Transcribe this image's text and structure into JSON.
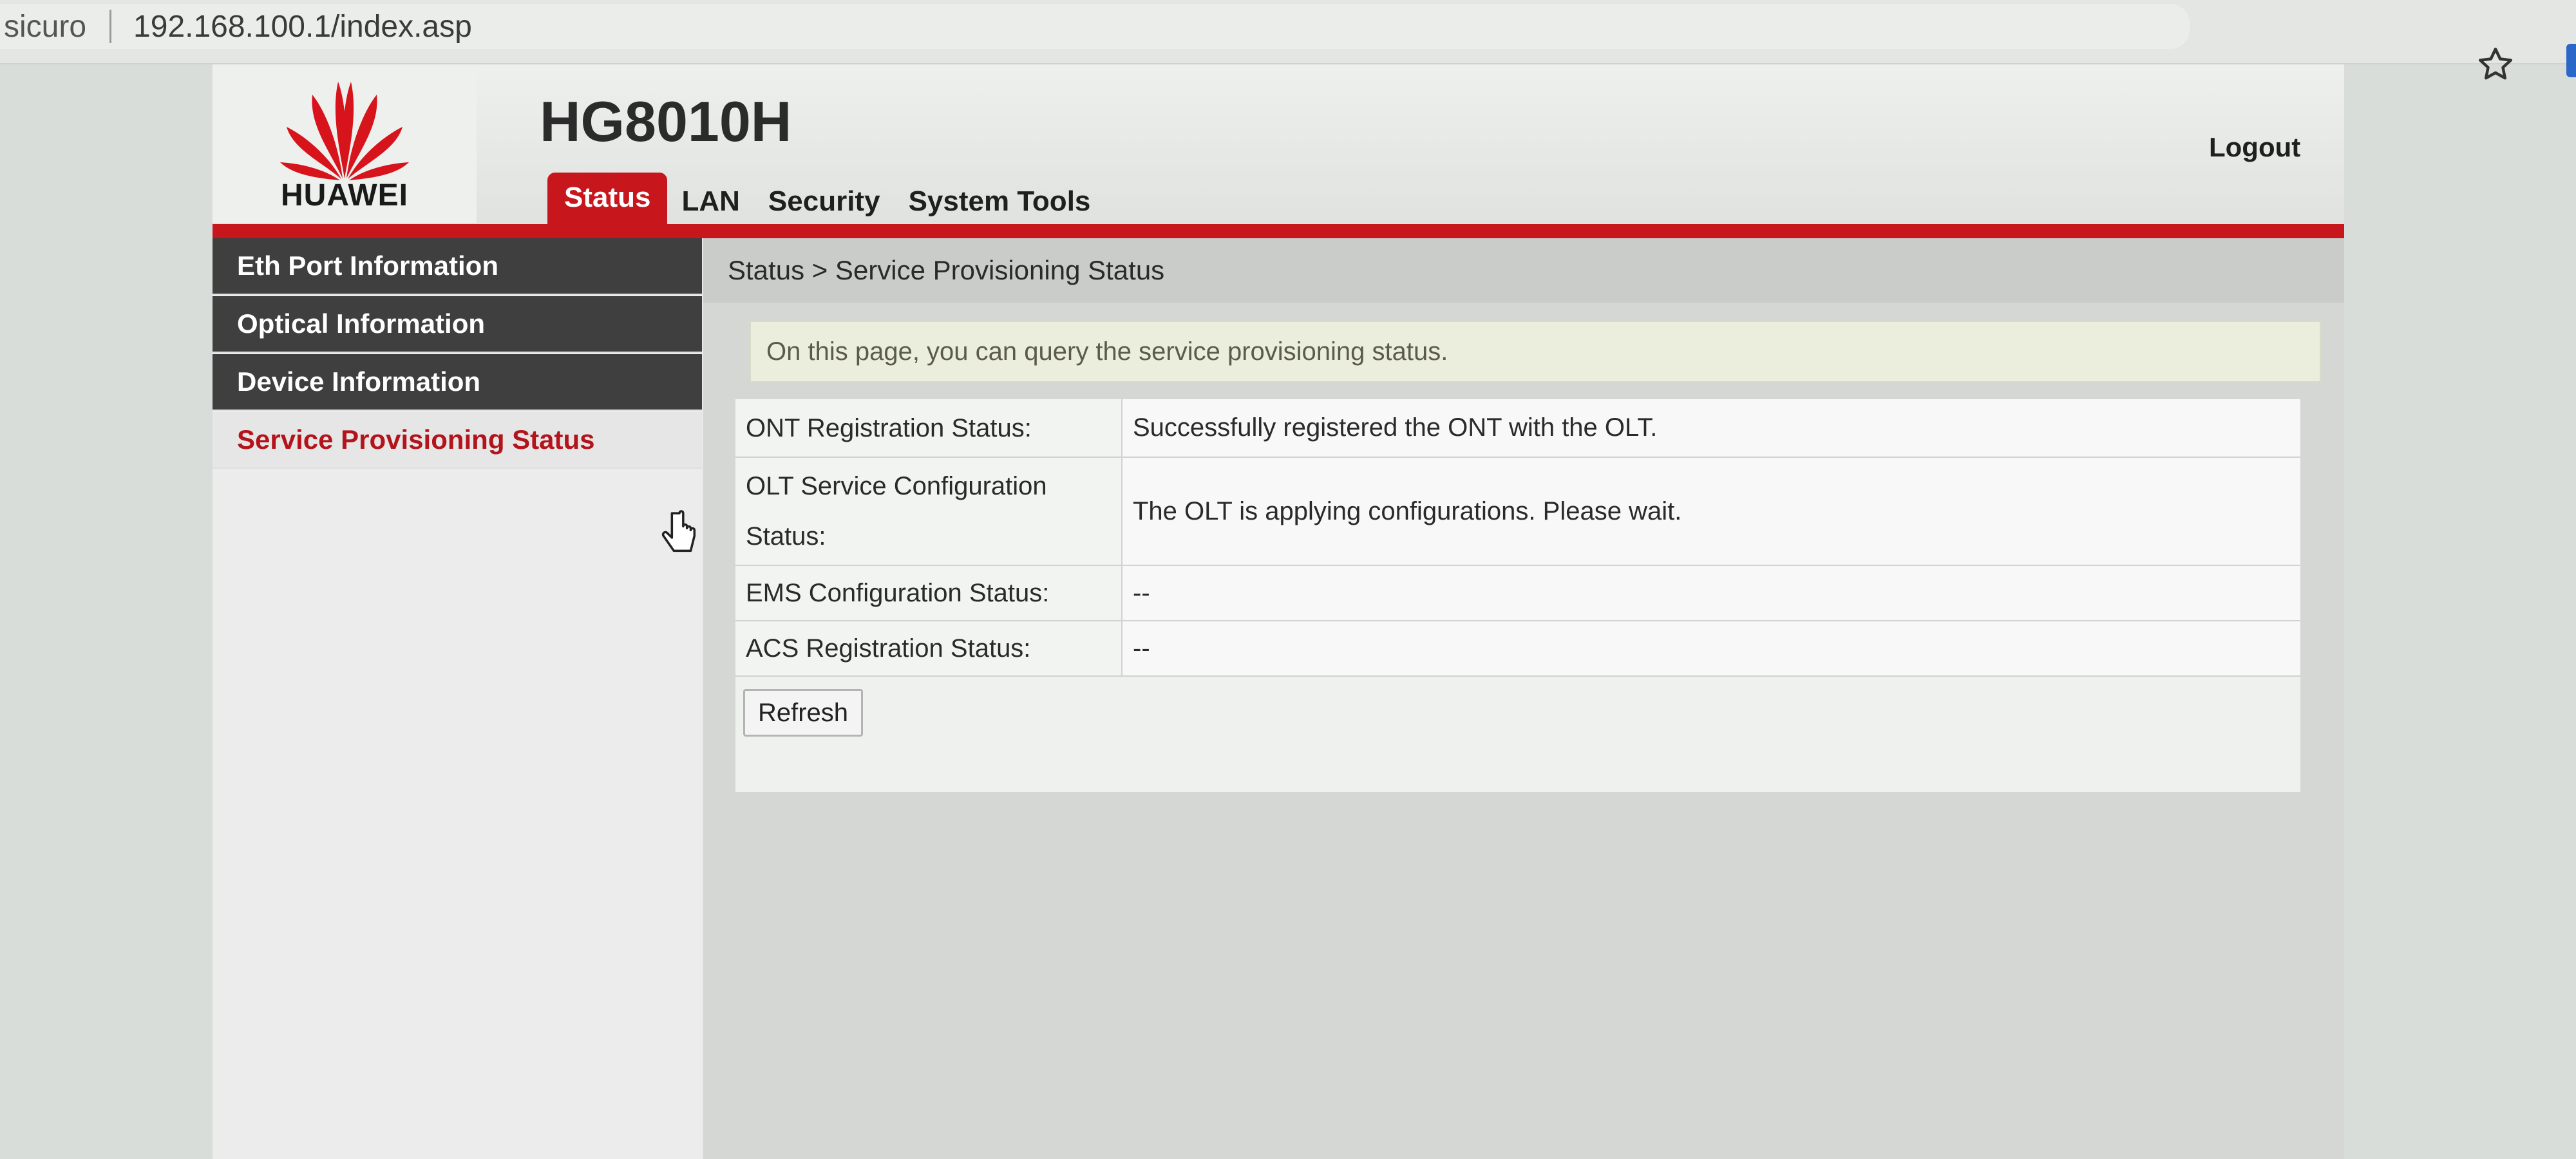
{
  "browser": {
    "security_label": "sicuro",
    "url": "192.168.100.1/index.asp"
  },
  "header": {
    "brand": "HUAWEI",
    "model": "HG8010H",
    "logout_label": "Logout",
    "tabs": [
      {
        "label": "Status",
        "active": true
      },
      {
        "label": "LAN",
        "active": false
      },
      {
        "label": "Security",
        "active": false
      },
      {
        "label": "System Tools",
        "active": false
      }
    ]
  },
  "sidebar": {
    "items": [
      {
        "label": "Eth Port Information",
        "active": false
      },
      {
        "label": "Optical Information",
        "active": false
      },
      {
        "label": "Device Information",
        "active": false
      },
      {
        "label": "Service Provisioning Status",
        "active": true
      }
    ]
  },
  "main": {
    "breadcrumb": "Status > Service Provisioning Status",
    "notice": "On this page, you can query the service provisioning status.",
    "rows": [
      {
        "label": "ONT Registration Status:",
        "value": "Successfully registered the ONT with the OLT."
      },
      {
        "label": "OLT Service Configuration Status:",
        "value": "The OLT is applying configurations. Please wait."
      },
      {
        "label": "EMS Configuration Status:",
        "value": "--"
      },
      {
        "label": "ACS Registration Status:",
        "value": "--"
      }
    ],
    "refresh_label": "Refresh"
  },
  "colors": {
    "brand_red": "#c8161d",
    "sidebar_dark": "#3f3f3f"
  },
  "icons": [
    "star-icon",
    "huawei-logo-icon",
    "hand-cursor-icon"
  ]
}
